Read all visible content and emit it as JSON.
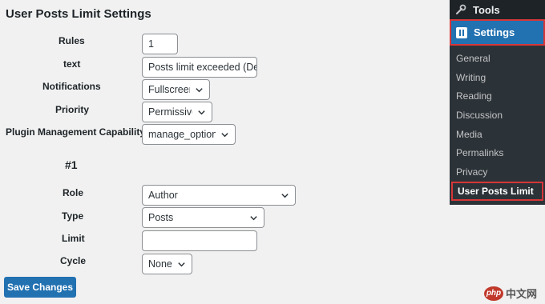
{
  "page": {
    "title": "User Posts Limit Settings",
    "save_label": "Save Changes"
  },
  "general_fields": [
    {
      "label": "Rules",
      "value": "1",
      "kind": "input"
    },
    {
      "label": "text",
      "value": "Posts limit exceeded (De",
      "kind": "input"
    },
    {
      "label": "Notifications",
      "value": "Fullscreen",
      "kind": "select"
    },
    {
      "label": "Priority",
      "value": "Permissive",
      "kind": "select"
    },
    {
      "label": "Plugin Management Capability",
      "value": "manage_options",
      "kind": "select"
    }
  ],
  "rule_section": {
    "heading": "#1",
    "fields": [
      {
        "label": "Role",
        "value": "Author",
        "kind": "select"
      },
      {
        "label": "Type",
        "value": "Posts",
        "kind": "select"
      },
      {
        "label": "Limit",
        "value": "",
        "kind": "input"
      },
      {
        "label": "Cycle",
        "value": "None",
        "kind": "select"
      }
    ]
  },
  "sidebar": {
    "tools_label": "Tools",
    "settings_label": "Settings",
    "items": [
      {
        "label": "General"
      },
      {
        "label": "Writing"
      },
      {
        "label": "Reading"
      },
      {
        "label": "Discussion"
      },
      {
        "label": "Media"
      },
      {
        "label": "Permalinks"
      },
      {
        "label": "Privacy"
      },
      {
        "label": "User Posts Limit",
        "active": true
      }
    ]
  },
  "watermark": {
    "logo": "php",
    "text": "中文网"
  },
  "colors": {
    "accent": "#2271b1",
    "highlight": "#d63638",
    "sidebar_bg": "#2c3338"
  }
}
